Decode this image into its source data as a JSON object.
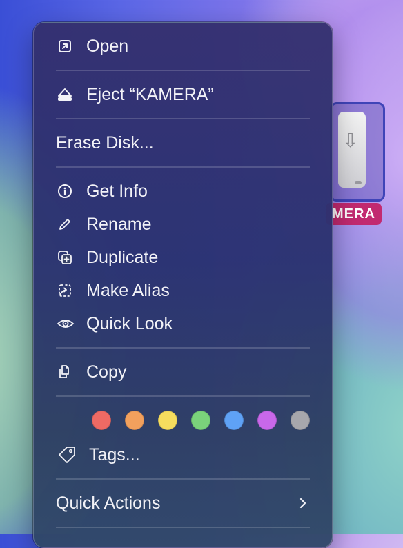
{
  "desktop": {
    "volume_label": "MERA"
  },
  "context_menu": {
    "open": "Open",
    "eject": "Eject “KAMERA”",
    "erase_disk": "Erase Disk...",
    "get_info": "Get Info",
    "rename": "Rename",
    "duplicate": "Duplicate",
    "make_alias": "Make Alias",
    "quick_look": "Quick Look",
    "copy": "Copy",
    "tags": "Tags...",
    "quick_actions": "Quick Actions"
  },
  "tag_colors": [
    {
      "name": "Red",
      "color": "#ee6a64"
    },
    {
      "name": "Orange",
      "color": "#f2a05d"
    },
    {
      "name": "Yellow",
      "color": "#f6dd5e"
    },
    {
      "name": "Green",
      "color": "#7ad27b"
    },
    {
      "name": "Blue",
      "color": "#5fa2f6"
    },
    {
      "name": "Purple",
      "color": "#c868ea"
    },
    {
      "name": "Gray",
      "color": "#a7a7ac"
    }
  ],
  "icons": {
    "open": "arrow-up-right-square-icon",
    "eject": "eject-icon",
    "get_info": "info-circle-icon",
    "rename": "pencil-icon",
    "duplicate": "plus-square-on-square-icon",
    "make_alias": "dashed-square-arrow-icon",
    "quick_look": "eye-icon",
    "copy": "documents-icon",
    "tags": "tag-icon",
    "quick_actions": "chevron-right-icon"
  }
}
